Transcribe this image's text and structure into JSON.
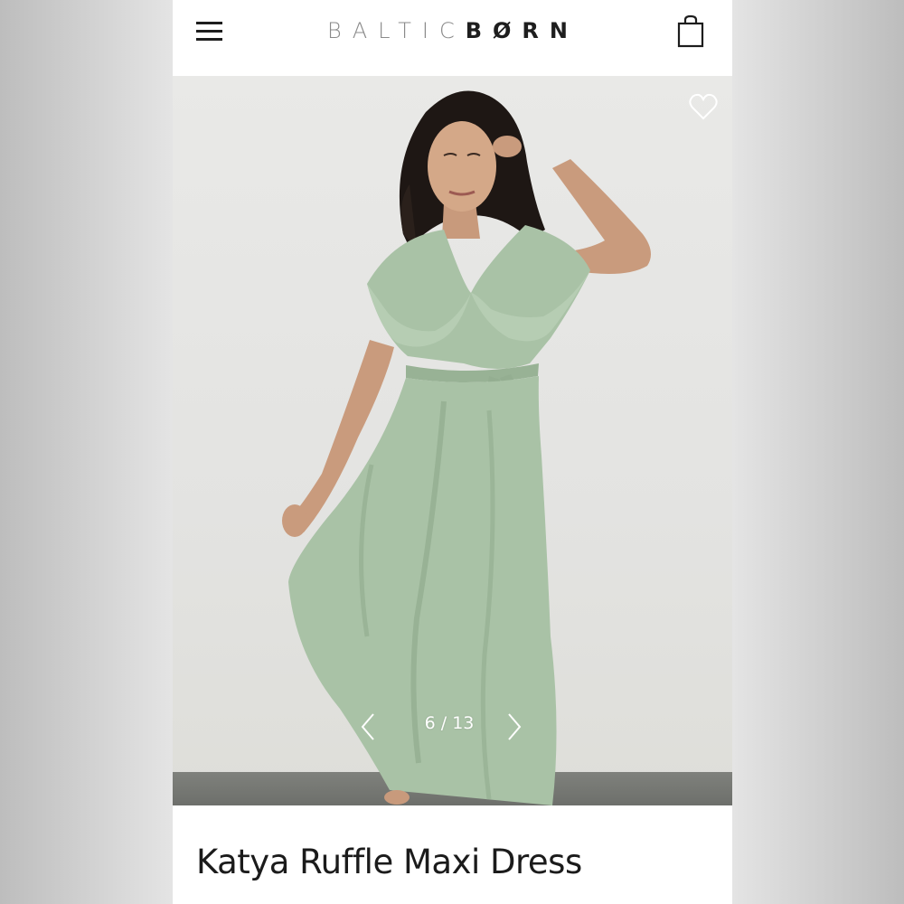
{
  "header": {
    "brand_light": "BALTIC",
    "brand_bold": "BØRN",
    "menu_icon": "hamburger-menu-icon",
    "cart_icon": "shopping-bag-icon"
  },
  "gallery": {
    "current": "6",
    "separator": " / ",
    "total": "13",
    "prev_icon": "chevron-left-icon",
    "next_icon": "chevron-right-icon",
    "wishlist_icon": "heart-outline-icon",
    "dress_color": "#a9c2a6"
  },
  "product": {
    "title": "Katya Ruffle Maxi Dress"
  }
}
